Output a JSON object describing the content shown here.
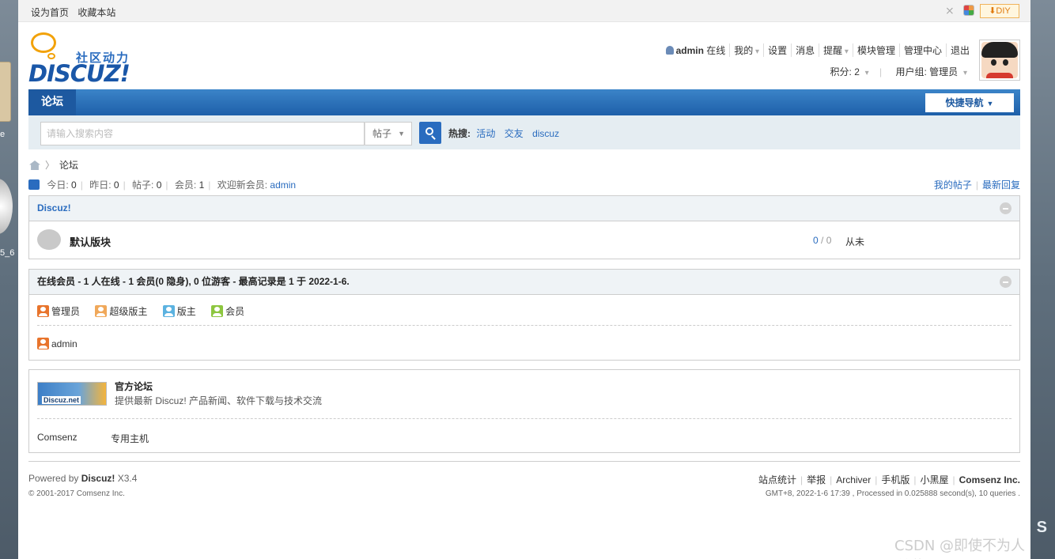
{
  "desktop": {
    "label_top": "e",
    "label": "5_6",
    "corner": "S"
  },
  "topbar": {
    "set_home": "设为首页",
    "bookmark": "收藏本站",
    "diy": "⬇DIY"
  },
  "logo": {
    "cn": "社区动力",
    "en": "DISCUZ!"
  },
  "usernav": {
    "username": "admin",
    "status": "在线",
    "items": [
      "我的",
      "设置",
      "消息",
      "提醒",
      "模块管理",
      "管理中心",
      "退出"
    ],
    "credits": "积分: 2",
    "group": "用户组: 管理员"
  },
  "nav": {
    "tab": "论坛",
    "quick_nav": "快捷导航"
  },
  "search": {
    "placeholder": "请输入搜索内容",
    "type": "帖子",
    "hot_label": "热搜:",
    "hot": [
      "活动",
      "交友",
      "discuz"
    ]
  },
  "breadcrumb": {
    "current": "论坛"
  },
  "stats": {
    "today_label": "今日:",
    "today": "0",
    "yesterday_label": "昨日:",
    "yesterday": "0",
    "posts_label": "帖子:",
    "posts": "0",
    "members_label": "会员:",
    "members": "1",
    "welcome_label": "欢迎新会员:",
    "newest": "admin",
    "my_posts": "我的帖子",
    "latest_replies": "最新回复"
  },
  "category": {
    "title": "Discuz!",
    "forum_name": "默认版块",
    "threads": "0",
    "posts": "0",
    "last_post": "从未"
  },
  "online": {
    "title": "在线会员 - 1 人在线 - 1 会员(0 隐身), 0 位游客 - 最高记录是 1 于 2022-1-6.",
    "legend": [
      "管理员",
      "超级版主",
      "版主",
      "会员"
    ],
    "user": "admin"
  },
  "friendlinks": {
    "logo_text": "Discuz.net",
    "title": "官方论坛",
    "desc": "提供最新 Discuz! 产品新闻、软件下载与技术交流",
    "links": [
      "Comsenz",
      "专用主机"
    ]
  },
  "footer": {
    "powered_prefix": "Powered by",
    "powered_name": "Discuz!",
    "version": "X3.4",
    "copyright": "© 2001-2017 Comsenz Inc.",
    "links": [
      "站点统计",
      "举报",
      "Archiver",
      "手机版",
      "小黑屋"
    ],
    "company": "Comsenz Inc.",
    "time": "GMT+8, 2022-1-6 17:39 , Processed in 0.025888 second(s), 10 queries ."
  },
  "watermark": "CSDN @即使不为人所道",
  "colors": {
    "link": "#2a6cbf",
    "nav": "#1e5fa9",
    "accent_orange": "#f2a20a"
  },
  "icons": [
    "shrink-icon",
    "color-palette-icon",
    "user-icon",
    "search-icon",
    "home-icon",
    "stats-icon",
    "collapse-icon",
    "forum-bubble-icon"
  ]
}
